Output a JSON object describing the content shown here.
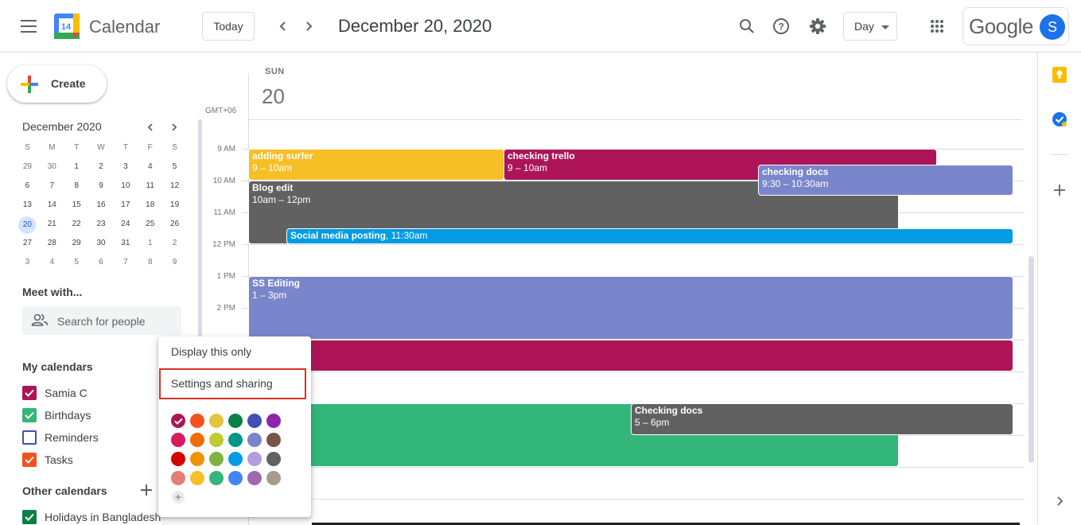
{
  "header": {
    "app_title": "Calendar",
    "logo_day": "14",
    "today_label": "Today",
    "date_title": "December 20, 2020",
    "view_label": "Day",
    "google_wordmark": "Google",
    "avatar_initial": "S",
    "icons": [
      "menu-icon",
      "prev-arrow-icon",
      "next-arrow-icon",
      "search-icon",
      "help-icon",
      "settings-icon",
      "apps-grid-icon"
    ]
  },
  "sidebar": {
    "create_label": "Create",
    "mini_calendar": {
      "month_label": "December 2020",
      "weekdays": [
        "S",
        "M",
        "T",
        "W",
        "T",
        "F",
        "S"
      ],
      "weeks": [
        [
          "29",
          "30",
          "1",
          "2",
          "3",
          "4",
          "5"
        ],
        [
          "6",
          "7",
          "8",
          "9",
          "10",
          "11",
          "12"
        ],
        [
          "13",
          "14",
          "15",
          "16",
          "17",
          "18",
          "19"
        ],
        [
          "20",
          "21",
          "22",
          "23",
          "24",
          "25",
          "26"
        ],
        [
          "27",
          "28",
          "29",
          "30",
          "31",
          "1",
          "2"
        ],
        [
          "3",
          "4",
          "5",
          "6",
          "7",
          "8",
          "9"
        ]
      ],
      "selected_day": "20"
    },
    "meet_with": {
      "title": "Meet with...",
      "placeholder": "Search for people"
    },
    "my_calendars": {
      "title": "My calendars",
      "items": [
        {
          "label": "Samia C",
          "color": "#ad1457",
          "checked": true
        },
        {
          "label": "Birthdays",
          "color": "#33b679",
          "checked": true
        },
        {
          "label": "Reminders",
          "color": "#3f51b5",
          "checked": false
        },
        {
          "label": "Tasks",
          "color": "#f4511e",
          "checked": true
        }
      ]
    },
    "other_calendars": {
      "title": "Other calendars",
      "items": [
        {
          "label": "Holidays in Bangladesh",
          "color": "#0b8043",
          "checked": true
        }
      ]
    }
  },
  "day_view": {
    "day_name": "SUN",
    "day_number": "20",
    "timezone": "GMT+06",
    "hours": [
      "9 AM",
      "10 AM",
      "11 AM",
      "12 PM",
      "1 PM",
      "2 PM"
    ],
    "events": [
      {
        "title": "adding surfer",
        "time": "9 – 10am",
        "color": "#f6bf26"
      },
      {
        "title": "checking trello",
        "time": "9 – 10am",
        "color": "#ad1457"
      },
      {
        "title": "checking docs",
        "time": "9:30 – 10:30am",
        "color": "#7986cb"
      },
      {
        "title": "Blog edit",
        "time": "10am – 12pm",
        "color": "#616161"
      },
      {
        "title": "Social media posting",
        "time": ", 11:30am",
        "color": "#039be5"
      },
      {
        "title": "SS Editing",
        "time": "1 – 3pm",
        "color": "#7986cb"
      },
      {
        "title": "",
        "time": "",
        "color": "#ad1457"
      },
      {
        "title": "",
        "time": "",
        "color": "#33b679"
      },
      {
        "title": "Checking docs",
        "time": "5 – 6pm",
        "color": "#616161"
      }
    ]
  },
  "context_menu": {
    "items": [
      "Display this only",
      "Settings and sharing"
    ],
    "highlighted_item": "Settings and sharing",
    "color_swatches": [
      [
        "#ad1457",
        "#f4511e",
        "#e4c441",
        "#0b8043",
        "#3f51b5",
        "#8e24aa"
      ],
      [
        "#d81b60",
        "#ef6c00",
        "#c0ca33",
        "#009688",
        "#7986cb",
        "#795548"
      ],
      [
        "#d50000",
        "#f09300",
        "#7cb342",
        "#039be5",
        "#b39ddb",
        "#616161"
      ],
      [
        "#e67c73",
        "#f6bf26",
        "#33b679",
        "#4285f4",
        "#9e69af",
        "#a79b8e"
      ]
    ],
    "selected_swatch": "#ad1457"
  },
  "right_rail": {
    "icons": [
      "keep-icon",
      "tasks-icon",
      "add-addon-icon",
      "expand-panel-icon"
    ]
  }
}
